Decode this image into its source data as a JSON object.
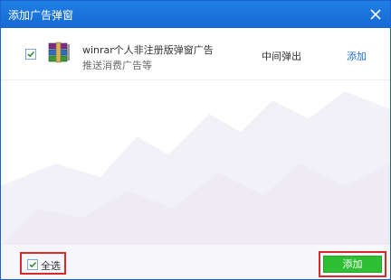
{
  "window": {
    "title": "添加广告弹窗"
  },
  "list": {
    "items": [
      {
        "checked": true,
        "name": "winrar个人非注册版弹窗广告",
        "description": "推送消费广告等",
        "type": "中间弹出",
        "action_label": "添加",
        "icon": "winrar-books-icon"
      }
    ]
  },
  "footer": {
    "select_all_label": "全选",
    "select_all_checked": true,
    "add_button_label": "添加"
  },
  "colors": {
    "titlebar": "#1669d2",
    "accent": "#1e6fd0",
    "add_button": "#2fbf33",
    "highlight_border": "#d62a2a"
  }
}
